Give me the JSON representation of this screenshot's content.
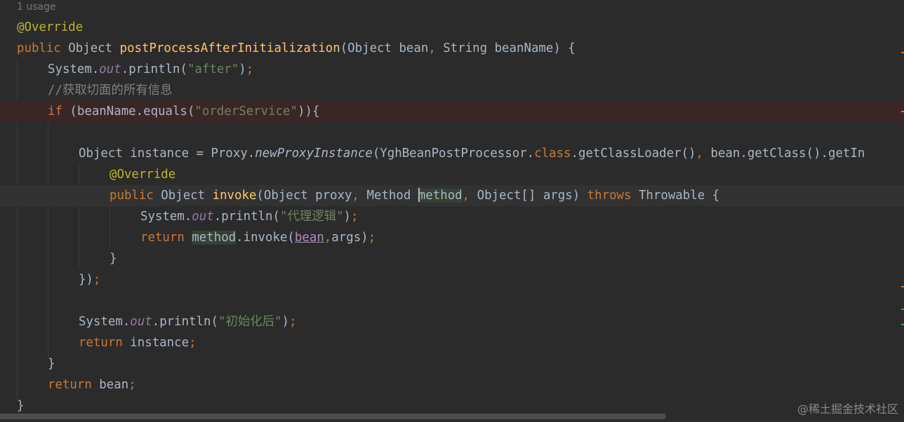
{
  "editor": {
    "usage_hint": "1 usage",
    "lines": {
      "l1": {
        "annotation": "@Override"
      },
      "l2": {
        "kw_public": "public",
        "type": " Object ",
        "method_name": "postProcessAfterInitialization",
        "params_a": "(Object bean",
        "comma": ",",
        "params_b": " String beanName) {"
      },
      "l3": {
        "a": "System.",
        "out": "out",
        "b": ".println(",
        "str": "\"after\"",
        "c": ")",
        "semi": ";"
      },
      "l4": {
        "comment": "//获取切面的所有信息"
      },
      "l5": {
        "kw_if": "if",
        "a": " (beanName.equals(",
        "str": "\"orderService\"",
        "b": ")){"
      },
      "l7": {
        "a": "Object instance = Proxy.",
        "static_call": "newProxyInstance",
        "b": "(YghBeanPostProcessor.",
        "kw_class": "class",
        "c": ".getClassLoader()",
        "comma": ",",
        "d": " bean.getClass().getIn"
      },
      "l8": {
        "annotation": "@Override"
      },
      "l9": {
        "kw_public": "public",
        "type": " Object ",
        "method_name": "invoke",
        "a": "(Object proxy",
        "comma1": ",",
        "b": " Method ",
        "param_m": "m",
        "param_rest": "ethod",
        "comma2": ",",
        "c": " Object[] args) ",
        "kw_throws": "throws",
        "d": " Throwable {"
      },
      "l10": {
        "a": "System.",
        "out": "out",
        "b": ".println(",
        "str": "\"代理逻辑\"",
        "c": ")",
        "semi": ";"
      },
      "l11": {
        "kw_return": "return",
        "space": " ",
        "ref_method": "method",
        "a": ".invoke(",
        "captured": "bean",
        "comma": ",",
        "b": "args)",
        "semi": ";"
      },
      "l12": {
        "brace": "}"
      },
      "l13": {
        "a": "})",
        "semi": ";"
      },
      "l15": {
        "a": "System.",
        "out": "out",
        "b": ".println(",
        "str": "\"初始化后\"",
        "c": ")",
        "semi": ";"
      },
      "l16": {
        "kw_return": "return",
        "a": " instance",
        "semi": ";"
      },
      "l17": {
        "brace": "}"
      },
      "l18": {
        "kw_return": "return",
        "a": " bean",
        "semi": ";"
      },
      "l19": {
        "brace": "}"
      }
    }
  },
  "watermark": "@稀土掘金技术社区",
  "colors": {
    "background": "#2b2b2b",
    "keyword": "#cc7832",
    "annotation": "#bbb529",
    "method_declaration": "#ffc66d",
    "string": "#6a8759",
    "comment": "#808080",
    "static_field": "#9876aa",
    "text": "#a9b7c6",
    "breakpoint_line": "#3b2626",
    "caret_line": "#323232"
  }
}
